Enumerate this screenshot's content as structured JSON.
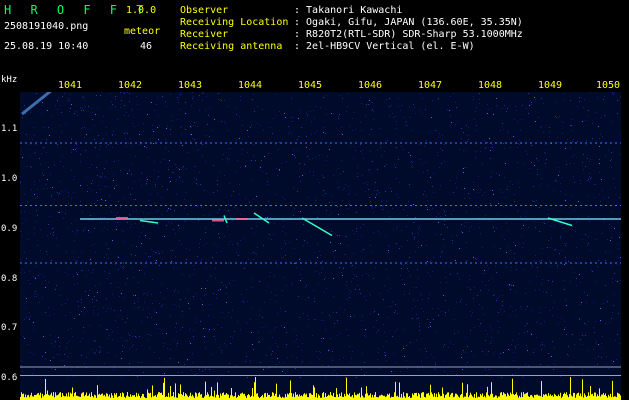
{
  "app": {
    "name": "H R O F F T",
    "version": "1.0.0",
    "file": "2508191040.png",
    "timestamp": "25.08.19 10:40",
    "meteor_label": "meteor",
    "meteor_count": "46"
  },
  "station": [
    {
      "label": "Observer",
      "value": ": Takanori Kawachi"
    },
    {
      "label": "Receiving Location",
      "value": ": Ogaki, Gifu, JAPAN (136.60E, 35.35N)"
    },
    {
      "label": "Receiver",
      "value": ": R820T2(RTL-SDR) SDR-Sharp 53.1000MHz"
    },
    {
      "label": "Receiving antenna",
      "value": ": 2el-HB9CV Vertical (el. E-W)"
    }
  ],
  "axis": {
    "y_unit": "kHz",
    "y_ticks": [
      "1.1",
      "1.0",
      "0.9",
      "0.8",
      "0.7",
      "0.6"
    ],
    "x_ticks": [
      "1041",
      "1042",
      "1043",
      "1044",
      "1045",
      "1046",
      "1047",
      "1048",
      "1049",
      "1050"
    ]
  },
  "colors": {
    "background": "#000000",
    "plot_bg": "#000a2a",
    "label_yellow": "#ffff00",
    "title_green": "#00ff66",
    "carrier": "#7fe0ff",
    "meteor": "#33ffcc",
    "meteor_hot": "#ff6090",
    "signal_bar": "#ffff00",
    "reference_line": "#9aa0c0"
  },
  "meteor_tracks": [
    {
      "x0": 1043.7,
      "f0": 0.925,
      "x1": 1043.75,
      "f1": 0.91
    },
    {
      "x0": 1044.2,
      "f0": 0.93,
      "x1": 1044.45,
      "f1": 0.91
    },
    {
      "x0": 1045.0,
      "f0": 0.92,
      "x1": 1045.5,
      "f1": 0.885
    },
    {
      "x0": 1042.3,
      "f0": 0.915,
      "x1": 1042.6,
      "f1": 0.91
    },
    {
      "x0": 1049.1,
      "f0": 0.92,
      "x1": 1049.5,
      "f1": 0.905
    }
  ]
}
